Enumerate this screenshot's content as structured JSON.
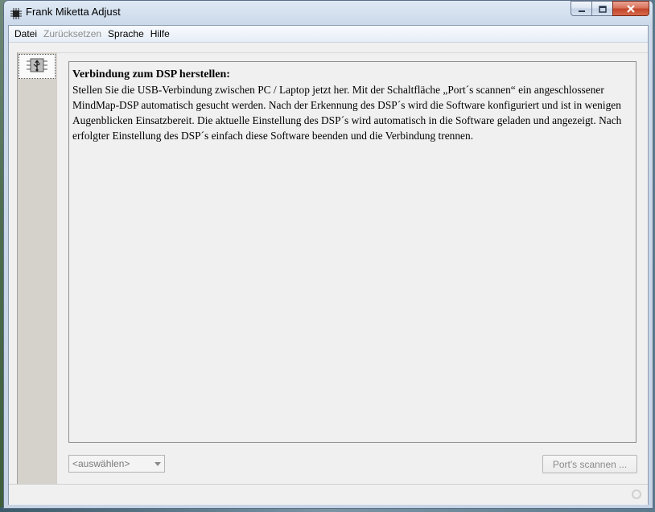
{
  "window": {
    "title": "Frank Miketta Adjust",
    "app_icon": "chip-icon",
    "buttons": [
      "minimize-icon",
      "maximize-icon",
      "close-icon"
    ]
  },
  "menubar": {
    "items": [
      {
        "label": "Datei",
        "enabled": true
      },
      {
        "label": "Zurücksetzen",
        "enabled": false
      },
      {
        "label": "Sprache",
        "enabled": true
      },
      {
        "label": "Hilfe",
        "enabled": true
      }
    ]
  },
  "sidebar": {
    "items": [
      {
        "icon": "usb-icon",
        "selected": true
      }
    ]
  },
  "content": {
    "heading": "Verbindung zum DSP herstellen:",
    "body": "Stellen Sie die USB-Verbindung zwischen PC / Laptop jetzt her. Mit der Schaltfläche „Port´s scannen“ ein angeschlossener MindMap-DSP automatisch gesucht werden. Nach der Erkennung des DSP´s wird die Software konfiguriert und ist in wenigen Augenblicken Einsatzbereit. Die aktuelle Einstellung des DSP´s wird automatisch in die Software geladen und angezeigt. Nach erfolgter Einstellung des DSP´s einfach diese Software beenden und die Verbindung trennen."
  },
  "controls": {
    "port_select": {
      "value": "<auswählen>",
      "enabled": false
    },
    "scan_button": {
      "label": "Port's scannen ...",
      "enabled": false
    }
  },
  "statusbar": {
    "indicator": "status-ring-icon"
  },
  "colors": {
    "client_bg": "#f0f0f0",
    "sidebar_bg": "#d5d1cb",
    "close_button": "#c3462b"
  }
}
